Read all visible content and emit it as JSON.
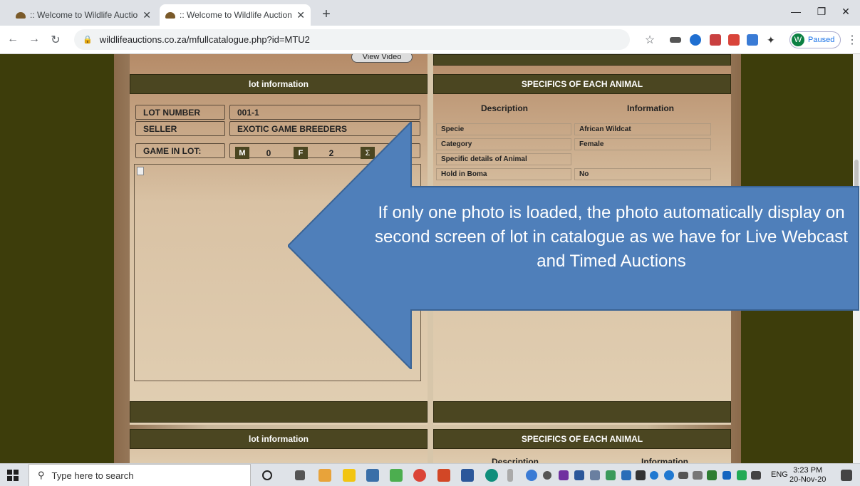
{
  "browser": {
    "tabs": [
      {
        "title": ":: Welcome to Wildlife Auctions ::"
      },
      {
        "title": ":: Welcome to Wildlife Auctions ::"
      }
    ],
    "new_tab": "+",
    "url": "wildlifeauctions.co.za/mfullcatalogue.php?id=MTU2",
    "profile_initial": "W",
    "profile_status": "Paused"
  },
  "page": {
    "view_video_label": "View Video",
    "lot_panel": {
      "header": "lot information",
      "lot_number_label": "LOT NUMBER",
      "lot_number_value": "001-1",
      "seller_label": "SELLER",
      "seller_value": "EXOTIC GAME BREEDERS",
      "game_in_lot_label": "GAME IN LOT:",
      "male_tag": "M",
      "male_count": "0",
      "female_tag": "F",
      "female_count": "2",
      "total_tag": "Σ"
    },
    "specifics_panel": {
      "header": "SPECIFICS OF EACH ANIMAL",
      "col_description": "Description",
      "col_information": "Information",
      "rows": [
        {
          "label": "Specie",
          "value": "African Wildcat"
        },
        {
          "label": "Category",
          "value": "Female"
        },
        {
          "label": "Specific details of Animal",
          "value": ""
        },
        {
          "label": "Hold in Boma",
          "value": "No"
        }
      ]
    },
    "next_lot_header": "lot information",
    "next_specifics_header": "SPECIFICS OF EACH ANIMAL",
    "next_col_description": "Description",
    "next_col_information": "Information"
  },
  "callout": {
    "text": "If only one photo is loaded, the photo automatically display on second screen of lot in catalogue as we have for Live Webcast and Timed Auctions",
    "fill": "#4f7fba",
    "stroke": "#3a6394"
  },
  "taskbar": {
    "search_placeholder": "Type here to search",
    "language": "ENG",
    "time": "3:23 PM",
    "date": "20-Nov-20"
  }
}
